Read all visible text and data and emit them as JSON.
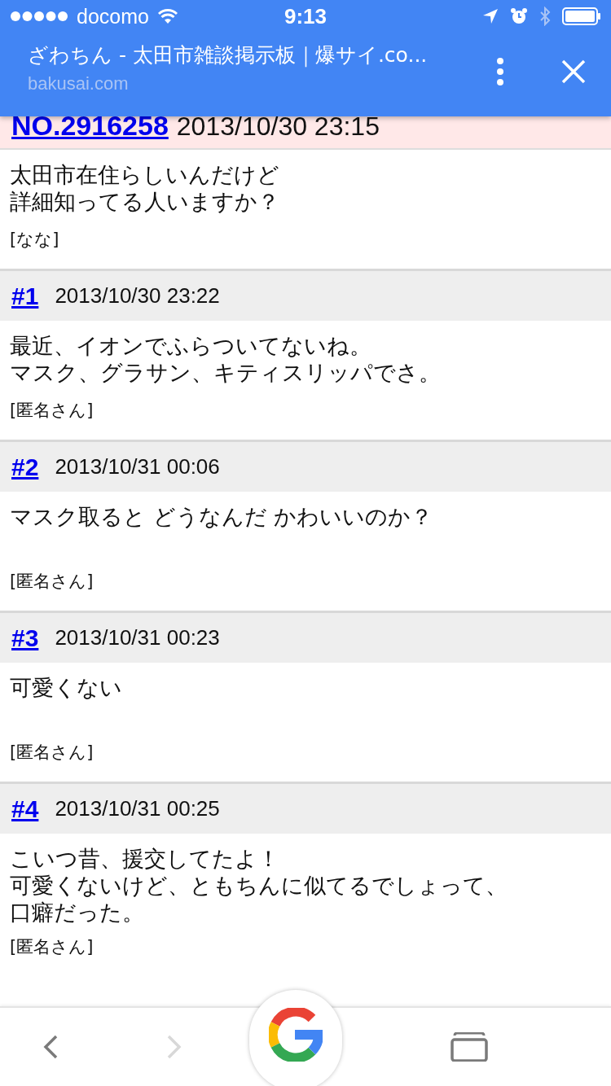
{
  "status_bar": {
    "carrier": "docomo",
    "time": "9:13"
  },
  "browser": {
    "title": "ざわちん - 太田市雑談掲示板｜爆サイ.co...",
    "url": "bakusai.com"
  },
  "pinned_post": {
    "number": "NO.2916258",
    "datetime": "2013/10/30 23:15",
    "lines": [
      "太田市在住らしいんだけど",
      "詳細知ってる人いますか？"
    ],
    "author": "[なな]"
  },
  "posts": [
    {
      "number": "#1",
      "datetime": "2013/10/30 23:22",
      "lines": [
        "最近、イオンでふらついてないね。",
        "マスク、グラサン、キティスリッパでさ。"
      ],
      "author": "[匿名さん]"
    },
    {
      "number": "#2",
      "datetime": "2013/10/31 00:06",
      "lines": [
        "マスク取ると どうなんだ かわいいのか？"
      ],
      "author": "[匿名さん]"
    },
    {
      "number": "#3",
      "datetime": "2013/10/31 00:23",
      "lines": [
        "可愛くない"
      ],
      "author": "[匿名さん]"
    },
    {
      "number": "#4",
      "datetime": "2013/10/31 00:25",
      "lines": [
        "こいつ昔、援交してたよ！",
        "可愛くないけど、ともちんに似てるでしょって、",
        "口癖だった。"
      ],
      "author": "[匿名さん]"
    }
  ]
}
